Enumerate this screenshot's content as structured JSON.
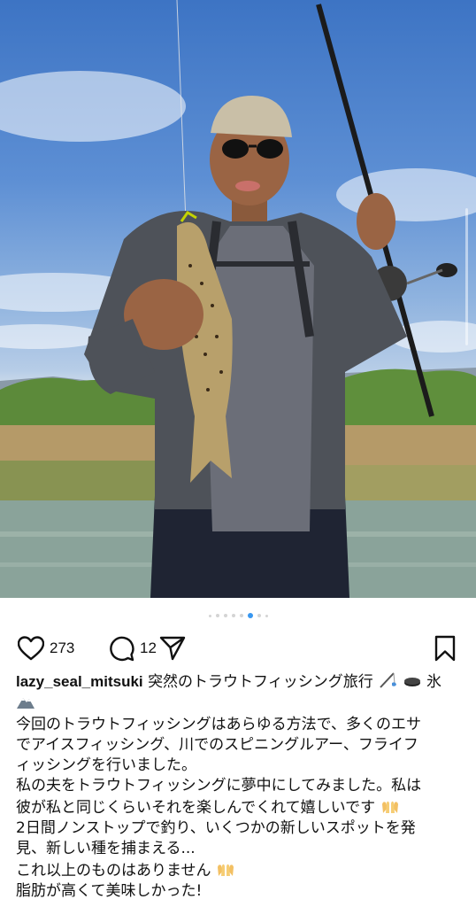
{
  "post": {
    "likes": "273",
    "comments": "12",
    "carousel": {
      "total": 8,
      "active_index": 5
    },
    "caption": {
      "username": "lazy_seal_mitsuki",
      "title_prefix": "突然のトラウトフィッシング旅行",
      "title_suffix": "氷",
      "lines": [
        "今回のトラウトフィッシングはあらゆる方法で、多くのエサ",
        "でアイスフィッシング、川でのスピニングルアー、フライフ",
        "ィッシングを行いました。",
        "私の夫をトラウトフィッシングに夢中にしてみました。私は",
        "彼が私と同じくらいそれを楽しんでくれて嬉しいです",
        "2日間ノンストップで釣り、いくつかの新しいスポットを発",
        "見、新しい種を捕まえる...",
        "これ以上のものはありません",
        "脂肪が高くて美味しかった!"
      ]
    }
  },
  "icons": {
    "like": "heart-outline-icon",
    "comment": "comment-bubble-icon",
    "share": "paper-plane-icon",
    "save": "bookmark-outline-icon",
    "emoji_1": "fishing-pole-emoji",
    "emoji_2": "ice-hockey-puck-emoji",
    "emoji_3": "mountain-emoji",
    "emoji_4": "raised-hands-emoji"
  },
  "colors": {
    "text": "#111111",
    "active_dot": "#3897f0",
    "inactive_dot": "#d4d4d4"
  }
}
